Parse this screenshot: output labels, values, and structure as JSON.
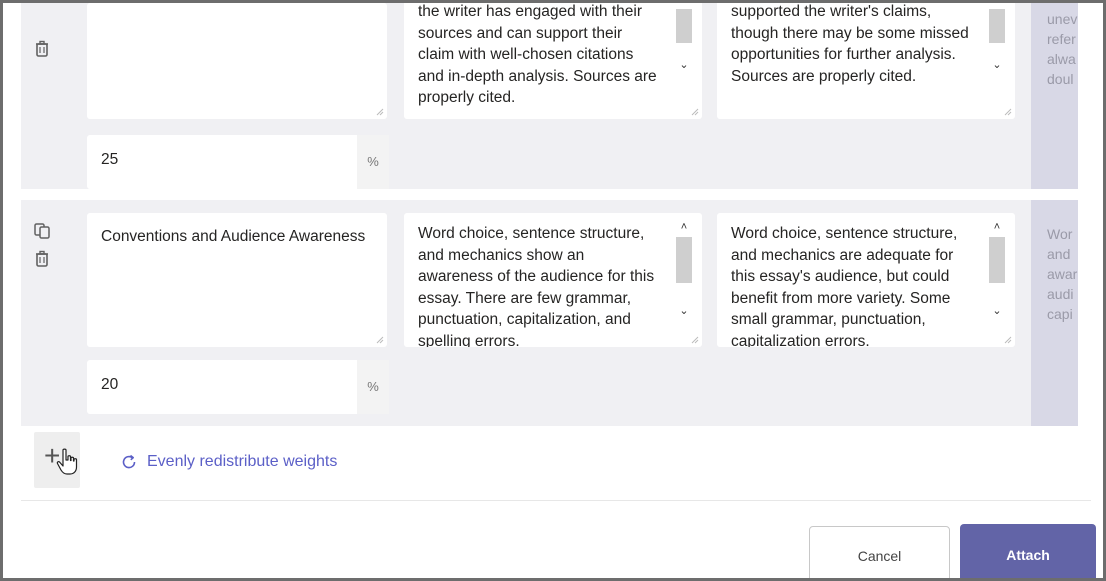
{
  "criteria": [
    {
      "name": "",
      "descriptions": [
        "the writer has engaged with their sources and can support their claim with well-chosen citations and in-depth analysis. Sources are properly cited.",
        "supported the writer's claims, though there may be some missed opportunities for further analysis. Sources are properly cited."
      ],
      "partial_text": "unev refer alwa doul",
      "weight": "25",
      "weight_unit": "%"
    },
    {
      "name": "Conventions and Audience Awareness",
      "descriptions": [
        "Word choice, sentence structure, and mechanics show an awareness of the audience for this essay. There are few grammar, punctuation, capitalization, and spelling errors.",
        "Word choice, sentence structure, and mechanics are adequate for this essay's audience, but could benefit from more variety. Some small grammar, punctuation, capitalization errors."
      ],
      "partial_text": "Wor and awar audi capi",
      "weight": "20",
      "weight_unit": "%"
    }
  ],
  "actions": {
    "redistribute_label": "Evenly redistribute weights",
    "cancel_label": "Cancel",
    "attach_label": "Attach"
  },
  "colors": {
    "accent": "#6264a7",
    "link": "#5b5fc7",
    "row_background": "#f0f0f3"
  },
  "icons": [
    "duplicate-icon",
    "delete-icon",
    "add-icon",
    "refresh-icon",
    "hand-cursor-icon"
  ]
}
